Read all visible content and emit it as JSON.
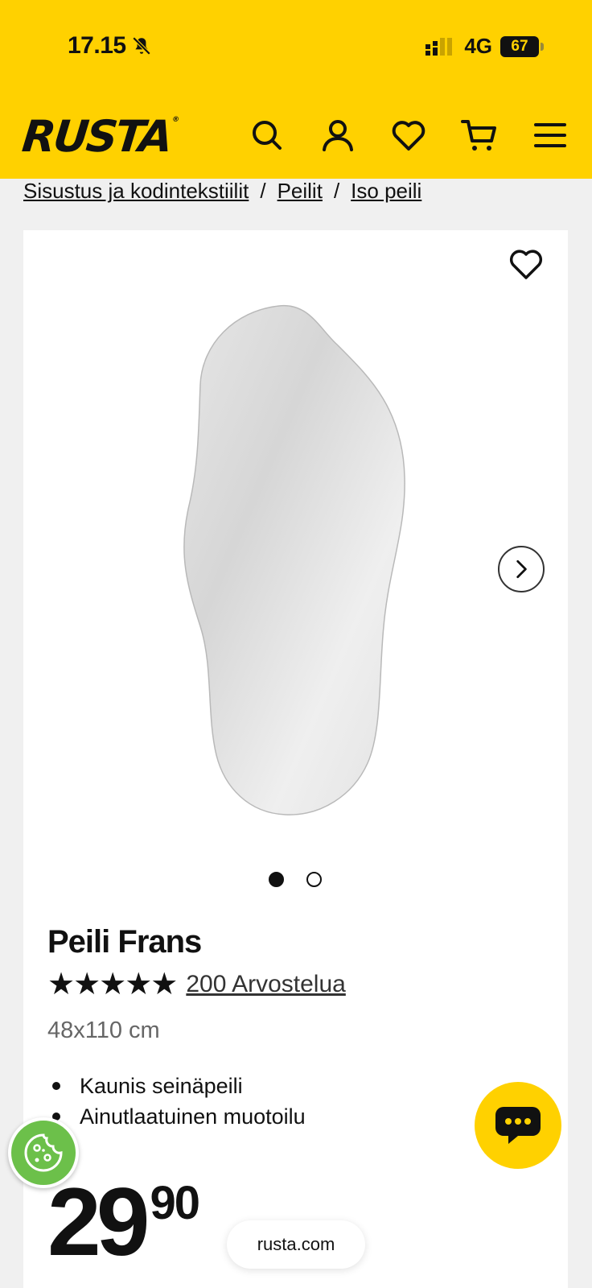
{
  "status_bar": {
    "time": "17.15",
    "network": "4G",
    "battery": "67"
  },
  "header": {
    "logo": "RUSTA",
    "icons": [
      "search-icon",
      "account-icon",
      "heart-icon",
      "cart-icon",
      "menu-icon"
    ]
  },
  "breadcrumb": {
    "items": [
      "Sisustus ja kodintekstiilit",
      "Peilit",
      "Iso peili"
    ],
    "separator": "/"
  },
  "gallery": {
    "image_count": 2,
    "active_index": 0
  },
  "product": {
    "title": "Peili Frans",
    "stars": "★★★★★",
    "reviews": "200 Arvostelua",
    "size": "48x110 cm",
    "features": [
      "Kaunis seinäpeili",
      "Ainutlaatuinen muotoilu"
    ],
    "price_main": "29",
    "price_cents": "90"
  },
  "browser": {
    "url": "rusta.com"
  },
  "colors": {
    "brand_yellow": "#ffd100",
    "cookie_green": "#6cc04a"
  }
}
